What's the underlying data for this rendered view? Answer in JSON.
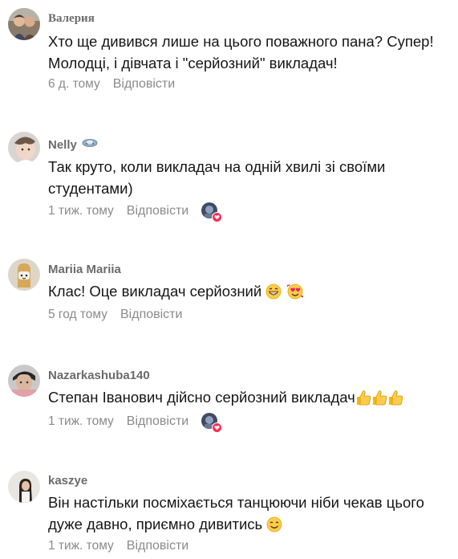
{
  "comments": [
    {
      "username": "Валерия",
      "text_lines": [
        "Хто ще дивився лише на цього поважного пана? Супер!",
        "Молодці, і дівчата і \"серйозний\" викладач!"
      ],
      "time": "6 д. тому",
      "reply_label": "Відповісти"
    },
    {
      "username": "Nelly",
      "text_lines": [
        "Так круто, коли викладач на одній хвилі зі своїми",
        "студентами)"
      ],
      "time": "1 тиж. тому",
      "reply_label": "Відповісти"
    },
    {
      "username": "Mariia Mariia",
      "text_lines": [
        "Клас! Оце викладач серйозний"
      ],
      "time": "5 год тому",
      "reply_label": "Відповісти"
    },
    {
      "username": "Nazarkashuba140",
      "text_lines": [
        "Степан Іванович дійсно серйозний викладач"
      ],
      "time": "1 тиж. тому",
      "reply_label": "Відповісти"
    },
    {
      "username": "kaszye",
      "text_lines": [
        "Він настільки посміхається танцюючи ніби чекав цього",
        "дуже давно, приємно дивитись"
      ],
      "time": "1 тиж. тому",
      "reply_label": "Відповісти"
    }
  ],
  "colors": {
    "username": "#6b6b6b",
    "meta": "#8a8a8a",
    "text": "#161616",
    "heart": "#fe2c55"
  }
}
